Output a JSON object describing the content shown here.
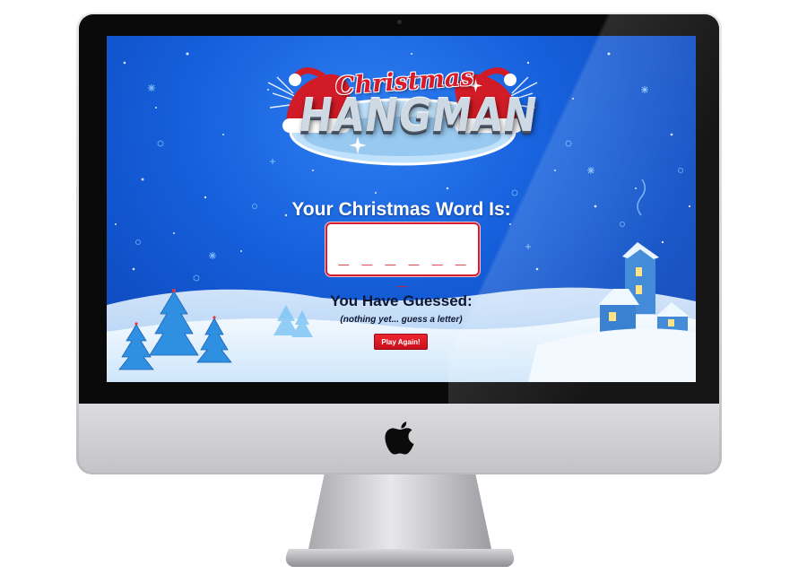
{
  "game": {
    "logo_top": "Christmas",
    "logo_main": "HANGMAN",
    "word_title": "Your Christmas Word Is:",
    "word_blanks": "_ _ _ _ _ _ _",
    "guessed_title": "You Have Guessed:",
    "guessed_list": "(nothing yet... guess a letter)",
    "play_again_label": "Play Again!"
  },
  "colors": {
    "accent_red": "#d21f2f",
    "sky_blue": "#1660dc"
  },
  "icons": [
    "apple-logo-icon",
    "santa-hat-icon",
    "christmas-tree-icon",
    "snow-house-icon"
  ]
}
